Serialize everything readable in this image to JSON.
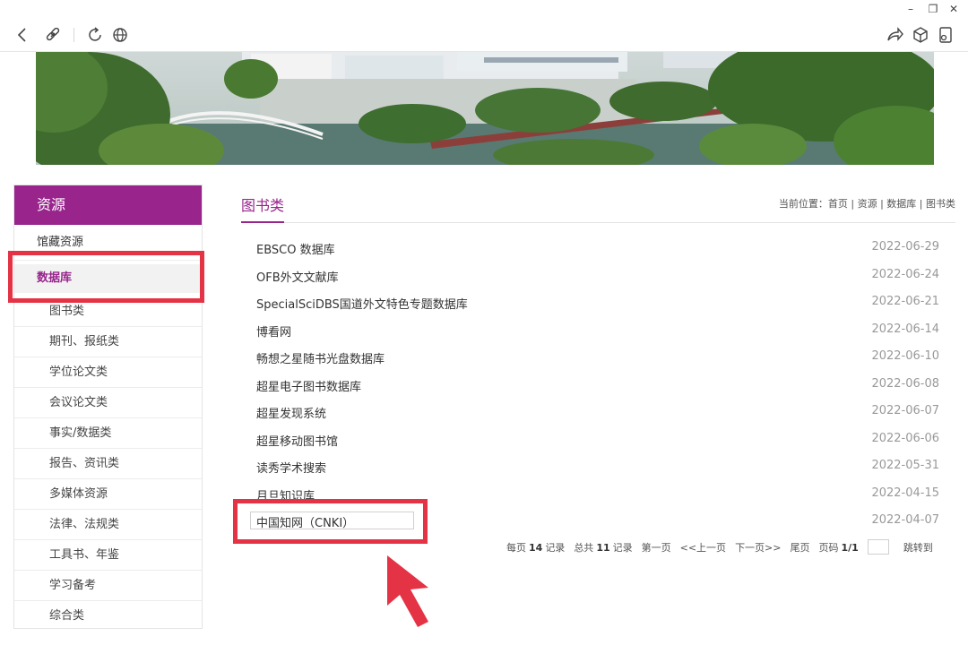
{
  "window": {
    "minimize_glyph": "–",
    "restore_glyph": "❐",
    "close_glyph": "✕"
  },
  "toolbar": {
    "icons": [
      "back-icon",
      "link-icon",
      "refresh-icon",
      "globe-icon",
      "share-icon",
      "cube-icon",
      "bookmark-icon"
    ]
  },
  "sidebar": {
    "header": "资源",
    "group_label": "馆藏资源",
    "active_label": "数据库",
    "items": [
      "图书类",
      "期刊、报纸类",
      "学位论文类",
      "会议论文类",
      "事实/数据类",
      "报告、资讯类",
      "多媒体资源",
      "法律、法规类",
      "工具书、年鉴",
      "学习备考",
      "综合类"
    ]
  },
  "content": {
    "title": "图书类",
    "breadcrumb": "当前位置：首页 | 资源 | 数据库 | 图书类",
    "rows": [
      {
        "title": "EBSCO 数据库",
        "date": "2022-06-29"
      },
      {
        "title": "OFB外文文献库",
        "date": "2022-06-24"
      },
      {
        "title": "SpecialSciDBS国道外文特色专题数据库",
        "date": "2022-06-21"
      },
      {
        "title": "博看网",
        "date": "2022-06-14"
      },
      {
        "title": "畅想之星随书光盘数据库",
        "date": "2022-06-10"
      },
      {
        "title": "超星电子图书数据库",
        "date": "2022-06-08"
      },
      {
        "title": "超星发现系统",
        "date": "2022-06-07"
      },
      {
        "title": "超星移动图书馆",
        "date": "2022-06-06"
      },
      {
        "title": "读秀学术搜索",
        "date": "2022-05-31"
      },
      {
        "title": "月旦知识库",
        "date": "2022-04-15"
      },
      {
        "title": "中国知网（CNKI）",
        "date": "2022-04-07"
      }
    ]
  },
  "pager": {
    "per_page_prefix": "每页",
    "per_page_value": "14",
    "per_page_suffix": "记录",
    "total_prefix": "总共",
    "total_value": "11",
    "total_suffix": "记录",
    "first": "第一页",
    "prev": "<<上一页",
    "next": "下一页>>",
    "last": "尾页",
    "page_prefix": "页码",
    "page_value": "1/1",
    "jump": "跳转到"
  },
  "colors": {
    "accent": "#98248c",
    "highlight": "#e53346"
  }
}
